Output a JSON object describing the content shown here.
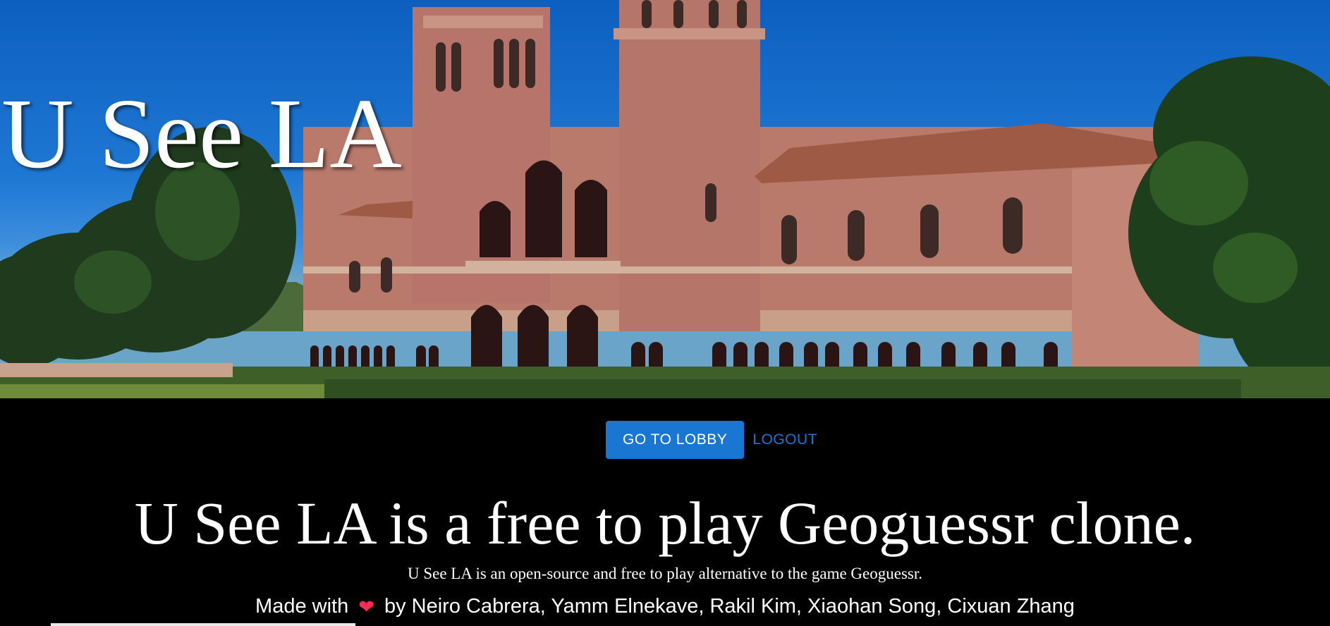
{
  "hero": {
    "title": "U See LA",
    "image": "royce-hall-ucla-photo"
  },
  "nav": {
    "lobby_label": "GO TO LOBBY",
    "logout_label": "LOGOUT"
  },
  "content": {
    "headline": "U See LA is a free to play Geoguessr clone.",
    "subtitle": "U See LA is an open-source and free to play alternative to the game Geoguessr.",
    "made_with": "Made with",
    "heart_icon": "sparkling-heart-icon",
    "authors": "by Neiro Cabrera, Yamm Elnekave, Rakil Kim, Xiaohan Song, Cixuan Zhang"
  },
  "colors": {
    "accent": "#1976d2",
    "background": "#000000",
    "text": "#ffffff",
    "heart": "#ff2b55"
  }
}
